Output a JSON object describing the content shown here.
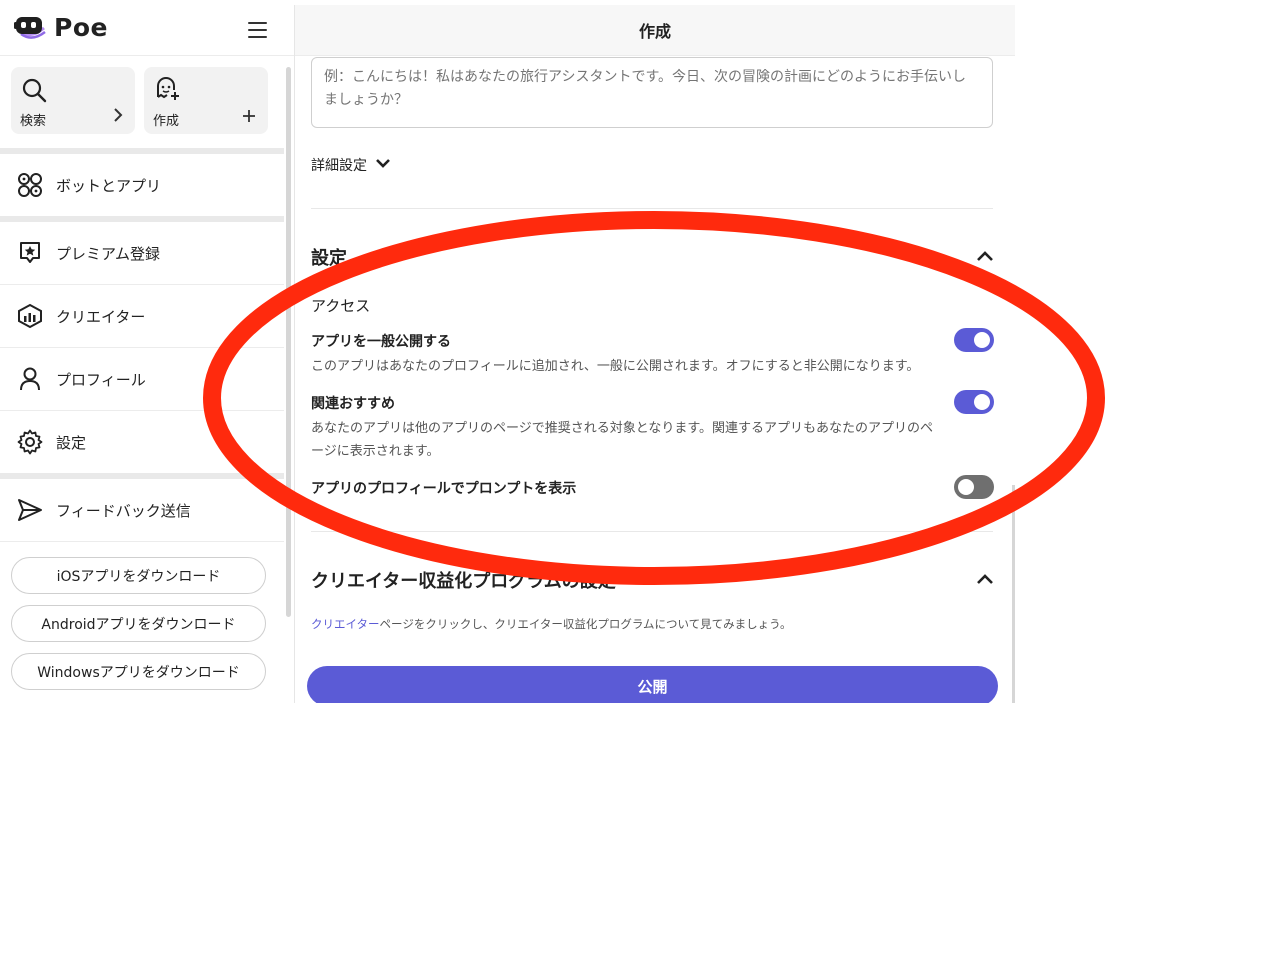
{
  "sidebar": {
    "logo_text": "Poe",
    "quick_actions": [
      {
        "label": "検索",
        "icon": "search-icon",
        "arrow": "›"
      },
      {
        "label": "作成",
        "icon": "create-bot-icon",
        "arrow": "+"
      }
    ],
    "nav": [
      {
        "label": "ボットとアプリ",
        "icon": "bots-apps-icon"
      },
      {
        "label": "プレミアム登録",
        "icon": "premium-icon"
      },
      {
        "label": "クリエイター",
        "icon": "creator-icon"
      },
      {
        "label": "プロフィール",
        "icon": "profile-icon"
      },
      {
        "label": "設定",
        "icon": "gear-icon"
      },
      {
        "label": "フィードバック送信",
        "icon": "send-icon"
      }
    ],
    "downloads": [
      {
        "label": "iOSアプリをダウンロード"
      },
      {
        "label": "Androidアプリをダウンロード"
      },
      {
        "label": "Windowsアプリをダウンロード"
      }
    ]
  },
  "main": {
    "title": "作成",
    "greeting_placeholder": "例：こんにちは！私はあなたの旅行アシスタントです。今日、次の冒険の計画にどのようにお手伝いしましょうか？",
    "advanced_label": "詳細設定",
    "settings": {
      "title": "設定",
      "access_label": "アクセス",
      "options": [
        {
          "title": "アプリを一般公開する",
          "desc": "このアプリはあなたのプロフィールに追加され、一般に公開されます。オフにすると非公開になります。",
          "on": true
        },
        {
          "title": "関連おすすめ",
          "desc": "あなたのアプリは他のアプリのページで推奨される対象となります。関連するアプリもあなたのアプリのページに表示されます。",
          "on": true
        },
        {
          "title": "アプリのプロフィールでプロンプトを表示",
          "desc": "",
          "on": false
        }
      ]
    },
    "creator": {
      "title": "クリエイター収益化プログラムの設定",
      "note_link": "クリエイター",
      "note_rest": "ページをクリックし、クリエイター収益化プログラムについて見てみましょう。"
    },
    "publish_label": "公開"
  },
  "colors": {
    "accent": "#5b5bd6",
    "annotation": "#ff2a0d"
  }
}
